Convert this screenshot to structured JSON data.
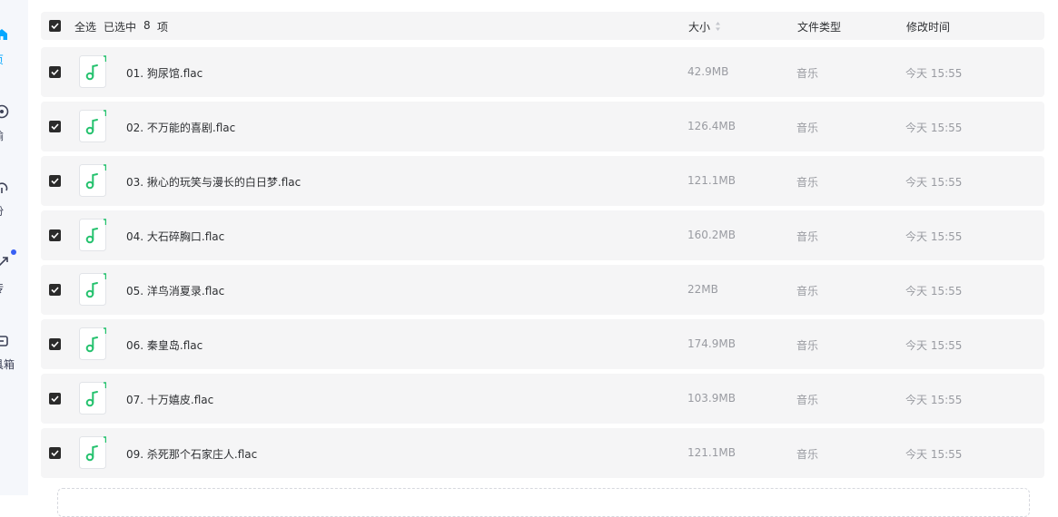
{
  "sidebar": {
    "items": [
      {
        "label": "页",
        "icon": "home-icon",
        "active": true
      },
      {
        "label": "输",
        "icon": "transfer-icon",
        "active": false
      },
      {
        "label": "份",
        "icon": "backup-icon",
        "active": false
      },
      {
        "label": "传",
        "icon": "share-icon",
        "active": false,
        "badge_dot": true
      },
      {
        "label": "具箱",
        "icon": "toolbox-icon",
        "active": false
      }
    ]
  },
  "header": {
    "select_all_label": "全选",
    "selected_prefix": "已选中",
    "selected_count": "8",
    "selected_suffix": "项",
    "col_size": "大小",
    "col_type": "文件类型",
    "col_modified": "修改时间"
  },
  "files": [
    {
      "name": "01. 狗尿馆.flac",
      "size": "42.9MB",
      "type": "音乐",
      "modified": "今天 15:55",
      "checked": true,
      "icon": "music-file-icon"
    },
    {
      "name": "02. 不万能的喜剧.flac",
      "size": "126.4MB",
      "type": "音乐",
      "modified": "今天 15:55",
      "checked": true,
      "icon": "music-file-icon"
    },
    {
      "name": "03. 揪心的玩笑与漫长的白日梦.flac",
      "size": "121.1MB",
      "type": "音乐",
      "modified": "今天 15:55",
      "checked": true,
      "icon": "music-file-icon"
    },
    {
      "name": "04. 大石碎胸口.flac",
      "size": "160.2MB",
      "type": "音乐",
      "modified": "今天 15:55",
      "checked": true,
      "icon": "music-file-icon"
    },
    {
      "name": "05. 洋鸟消夏录.flac",
      "size": "22MB",
      "type": "音乐",
      "modified": "今天 15:55",
      "checked": true,
      "icon": "music-file-icon"
    },
    {
      "name": "06. 秦皇岛.flac",
      "size": "174.9MB",
      "type": "音乐",
      "modified": "今天 15:55",
      "checked": true,
      "icon": "music-file-icon"
    },
    {
      "name": "07. 十万嬉皮.flac",
      "size": "103.9MB",
      "type": "音乐",
      "modified": "今天 15:55",
      "checked": true,
      "icon": "music-file-icon"
    },
    {
      "name": "09. 杀死那个石家庄人.flac",
      "size": "121.1MB",
      "type": "音乐",
      "modified": "今天 15:55",
      "checked": true,
      "icon": "music-file-icon"
    }
  ],
  "colors": {
    "accent": "#06a7ff",
    "music_green": "#25c26e",
    "row_bg": "#f5f5f6",
    "checkbox": "#2b2b2b",
    "badge_dot": "#3860f4"
  }
}
